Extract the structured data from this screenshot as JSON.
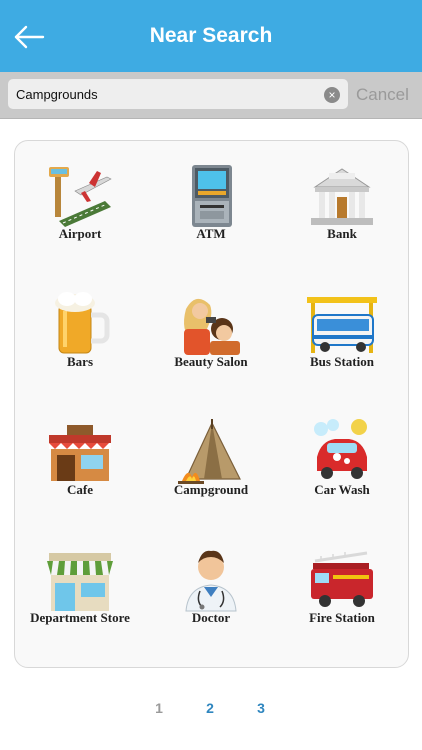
{
  "header": {
    "title": "Near Search"
  },
  "search": {
    "value": "Campgrounds",
    "cancel_label": "Cancel"
  },
  "categories": [
    {
      "label": "Airport",
      "icon": "airport-icon"
    },
    {
      "label": "ATM",
      "icon": "atm-icon"
    },
    {
      "label": "Bank",
      "icon": "bank-icon"
    },
    {
      "label": "Bars",
      "icon": "beer-mug-icon"
    },
    {
      "label": "Beauty Salon",
      "icon": "hair-salon-icon"
    },
    {
      "label": "Bus Station",
      "icon": "bus-station-icon"
    },
    {
      "label": "Cafe",
      "icon": "cafe-icon"
    },
    {
      "label": "Campground",
      "icon": "tent-campfire-icon"
    },
    {
      "label": "Car Wash",
      "icon": "car-wash-icon"
    },
    {
      "label": "Department Store",
      "icon": "department-store-icon"
    },
    {
      "label": "Doctor",
      "icon": "doctor-icon"
    },
    {
      "label": "Fire Station",
      "icon": "fire-truck-icon"
    }
  ],
  "pagination": {
    "pages": [
      "1",
      "2",
      "3"
    ],
    "current": "1"
  },
  "colors": {
    "header": "#3eabe3",
    "page_active": "#9a9a9a",
    "page_link": "#2f86bf"
  }
}
